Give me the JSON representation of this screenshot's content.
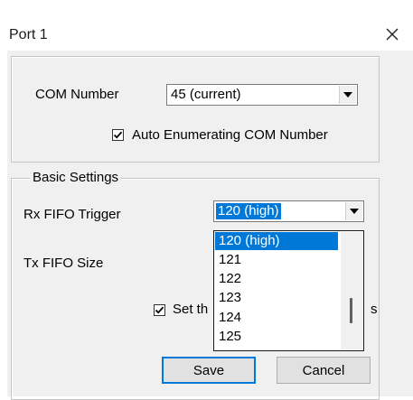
{
  "window": {
    "title": "Port 1"
  },
  "com": {
    "label": "COM Number",
    "value": "45 (current)",
    "auto_enum_label": "Auto Enumerating COM Number",
    "auto_enum_checked": true
  },
  "basic": {
    "legend": "Basic Settings",
    "rx_label": "Rx FIFO Trigger",
    "rx_value": "120 (high)",
    "tx_label": "Tx FIFO Size",
    "set_label_left": "Set th",
    "set_label_right": "s",
    "set_checked": true,
    "dropdown_items": [
      "120 (high)",
      "121",
      "122",
      "123",
      "124",
      "125"
    ],
    "dropdown_selected": "120 (high)"
  },
  "buttons": {
    "save": "Save",
    "cancel": "Cancel"
  },
  "colors": {
    "accent": "#0078d7",
    "dialog_bg": "#f0f0f0"
  }
}
